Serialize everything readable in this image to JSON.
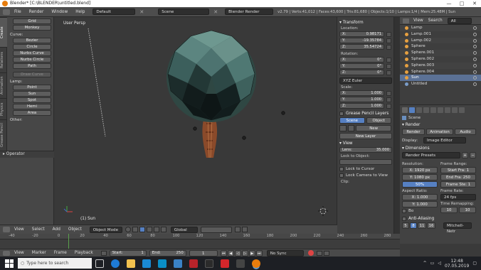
{
  "window": {
    "title": "Blender* [C:\\BLENDER\\untitled.blend]",
    "minimize": "—",
    "maximize": "□",
    "close": "✕"
  },
  "menu": {
    "items": [
      "File",
      "Render",
      "Window",
      "Help"
    ],
    "layout": "Default",
    "scene": "Scene",
    "engine": "Blender Render",
    "stats": "v2.79 | Verts:41,012 | Faces:43,600 | Tris:81,680 | Objects:1/10 | Lamps:1/4 | Mem:25.48M | Sun"
  },
  "tool_tabs": [
    "Create",
    "Relations",
    "Animation",
    "Physics",
    "Grease Pencil"
  ],
  "tools": {
    "top_buttons": [
      "Grid",
      "Monkey"
    ],
    "curve_label": "Curve:",
    "curve_buttons": [
      "Bezier",
      "Circle",
      "Nurbs Curve",
      "Nurbs Circle",
      "Path"
    ],
    "draw_curve": "Draw Curve",
    "lamp_label": "Lamp:",
    "lamp_buttons": [
      "Point",
      "Sun",
      "Spot",
      "Hemi",
      "Area"
    ],
    "other_label": "Other:"
  },
  "operator": "Operator",
  "viewport": {
    "persp": "User Persp",
    "object": "(1) Sun"
  },
  "viewport_header": {
    "items": [
      "View",
      "Select",
      "Add",
      "Object"
    ],
    "mode": "Object Mode",
    "orientation": "Global"
  },
  "npanel": {
    "transform": "Transform",
    "location": "Location:",
    "loc": [
      {
        "axis": "X:",
        "value": "0.98171"
      },
      {
        "axis": "Y:",
        "value": "-19.35784"
      },
      {
        "axis": "Z:",
        "value": "35.54724"
      }
    ],
    "rotation": "Rotation:",
    "rot": [
      {
        "axis": "X:",
        "value": "0°"
      },
      {
        "axis": "Y:",
        "value": "0°"
      },
      {
        "axis": "Z:",
        "value": "0°"
      }
    ],
    "rot_mode": "XYZ Euler",
    "scale": "Scale:",
    "scl": [
      {
        "axis": "X:",
        "value": "1.000"
      },
      {
        "axis": "Y:",
        "value": "1.000"
      },
      {
        "axis": "Z:",
        "value": "1.000"
      }
    ],
    "gp_layers": "Grease Pencil Layers",
    "gp_scene": "Scene",
    "gp_object": "Object",
    "gp_new": "New",
    "gp_new_layer": "New Layer",
    "view": "View",
    "lens_label": "Lens:",
    "lens_value": "35.000",
    "lock_to_object": "Lock to Object:",
    "lock_to_cursor": "Lock to Cursor",
    "lock_camera": "Lock Camera to View",
    "clip": "Clip:"
  },
  "outliner": {
    "menu": [
      "View",
      "Search",
      "All Scenes"
    ],
    "rows": [
      "Lamp",
      "Lamp.001",
      "Lamp.002",
      "Sphere",
      "Sphere.001",
      "Sphere.002",
      "Sphere.003",
      "Sphere.004",
      "Sun",
      "Untitled"
    ]
  },
  "props": {
    "scene": "Scene",
    "render": "Render",
    "render_btn": "Render",
    "animation_btn": "Animation",
    "audio_btn": "Audio",
    "display_label": "Display:",
    "display_value": "Image Editor",
    "dimensions": "Dimensions",
    "render_presets": "Render Presets",
    "resolution": "Resolution:",
    "res_x": "X: 1920 px",
    "res_y": "Y: 1080 px",
    "res_pct": "50%",
    "frame_range": "Frame Range:",
    "start": "Start Fra: 1",
    "end": "End Fra: 250",
    "step": "Frame Ste: 1",
    "aspect": "Aspect Ratio:",
    "asp_x": "X: 1.000",
    "asp_y": "Y: 1.000",
    "frame_rate": "Frame Rate:",
    "fps": "24 fps",
    "time_remap": "Time Remapping:",
    "remap_old": "10",
    "remap_new": "10",
    "border": "Bo",
    "anti_aliasing": "Anti-Aliasing",
    "aa_values": [
      "5",
      "8",
      "11",
      "16"
    ],
    "aa_filter": "Mitchell-Netr"
  },
  "timeline": {
    "ticks": [
      "-40",
      "-20",
      "0",
      "20",
      "40",
      "60",
      "80",
      "100",
      "120",
      "140",
      "160",
      "180",
      "200",
      "220",
      "240",
      "260",
      "280"
    ],
    "menu": [
      "View",
      "Marker",
      "Frame",
      "Playback"
    ],
    "start": "Start:",
    "start_val": "1",
    "end": "End:",
    "end_val": "250",
    "current": "1",
    "sync": "No Sync"
  },
  "taskbar": {
    "search": "Type here to search",
    "time": "12:48",
    "date": "07.05.2019"
  },
  "colors": {
    "accent": "#5680c2",
    "orange": "#e87d0d",
    "sphere": "#3f5a56"
  }
}
